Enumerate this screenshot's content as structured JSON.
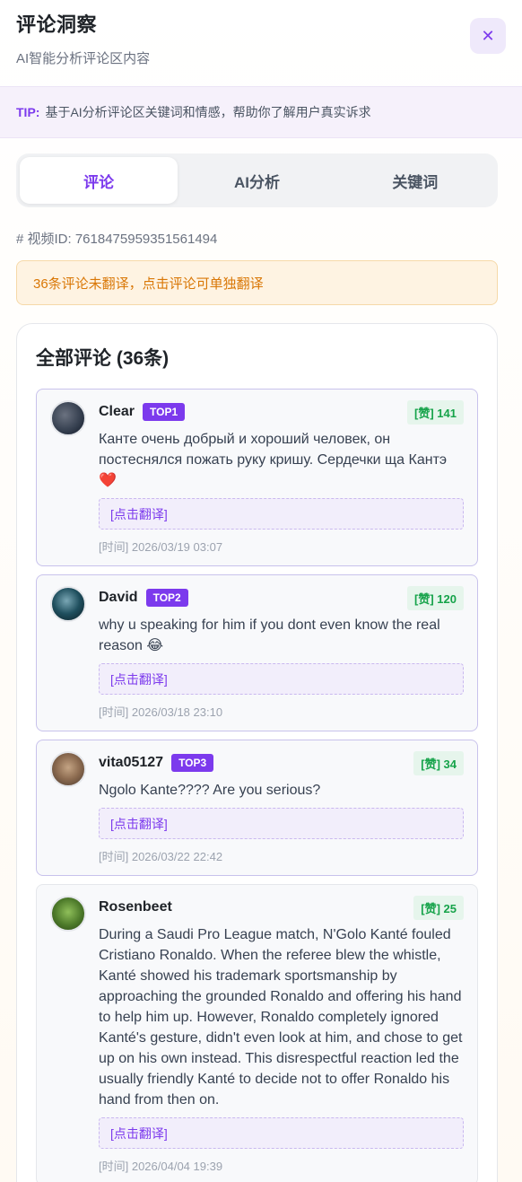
{
  "header": {
    "title": "评论洞察",
    "subtitle": "AI智能分析评论区内容",
    "close_label": "✕"
  },
  "tip": {
    "label": "TIP:",
    "text": "基于AI分析评论区关键词和情感，帮助你了解用户真实诉求"
  },
  "tabs": [
    {
      "label": "评论",
      "active": true
    },
    {
      "label": "AI分析",
      "active": false
    },
    {
      "label": "关键词",
      "active": false
    }
  ],
  "video_id": "# 视频ID: 7618475959351561494",
  "notice": "36条评论未翻译，点击评论可单独翻译",
  "panel_title": "全部评论 (36条)",
  "translate_label": "[点击翻译]",
  "comments": [
    {
      "author": "Clear",
      "badge": "TOP1",
      "likes": "[赞] 141",
      "text": "Канте очень добрый и хороший человек, он постеснялся пожать руку кришу. Сердечки ща Кантэ ❤️",
      "time": "[时间] 2026/03/19 03:07"
    },
    {
      "author": "David",
      "badge": "TOP2",
      "likes": "[赞] 120",
      "text": "why u speaking for him if you dont even know the real reason 😂",
      "time": "[时间] 2026/03/18 23:10"
    },
    {
      "author": "vita05127",
      "badge": "TOP3",
      "likes": "[赞] 34",
      "text": "Ngolo Kante???? Are you serious?",
      "time": "[时间] 2026/03/22 22:42"
    },
    {
      "author": "Rosenbeet",
      "badge": "",
      "likes": "[赞] 25",
      "text": "During a Saudi Pro League match, N'Golo Kanté fouled Cristiano Ronaldo. When the referee blew the whistle, Kanté showed his trademark sportsmanship by approaching the grounded Ronaldo and offering his hand to help him up. However, Ronaldo completely ignored Kanté's gesture, didn't even look at him, and chose to get up on his own instead. This disrespectful reaction led the usually friendly Kanté to decide not to offer Ronaldo his hand from then on.",
      "time": "[时间] 2026/04/04 19:39"
    }
  ]
}
